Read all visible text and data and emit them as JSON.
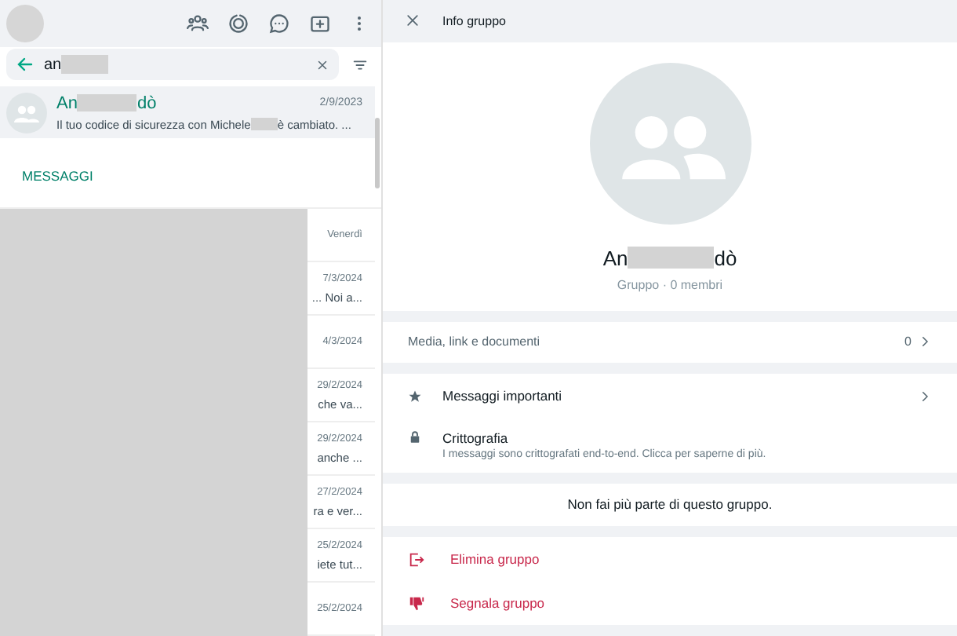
{
  "sidebar": {
    "search": {
      "value": "an"
    },
    "result": {
      "name_start": "An",
      "name_end": "dò",
      "date": "2/9/2023",
      "preview_start": "Il tuo codice di sicurezza con Michele",
      "preview_end": "è cambiato. ...",
      "selected": true
    },
    "section_label": "MESSAGGI",
    "messages": [
      {
        "date": "Venerdì"
      },
      {
        "date": "7/3/2024",
        "snippet": "... Noi a..."
      },
      {
        "date": "4/3/2024"
      },
      {
        "date": "29/2/2024",
        "snippet": "che va..."
      },
      {
        "date": "29/2/2024",
        "snippet": "anche ..."
      },
      {
        "date": "27/2/2024",
        "snippet": "ra e ver..."
      },
      {
        "date": "25/2/2024",
        "snippet": "iete tut..."
      },
      {
        "date": "25/2/2024"
      }
    ]
  },
  "info": {
    "title": "Info gruppo",
    "name_start": "An",
    "name_end": "dò",
    "subtitle": "Gruppo · 0 membri",
    "media": {
      "label": "Media, link e documenti",
      "count": "0"
    },
    "rows": [
      {
        "kind": "starred",
        "label": "Messaggi importanti"
      },
      {
        "kind": "encryption",
        "label": "Crittografia",
        "detail": "I messaggi sono crittografati end-to-end. Clicca per saperne di più."
      }
    ],
    "notice": "Non fai più parte di questo gruppo.",
    "actions": [
      {
        "kind": "exit",
        "label": "Elimina gruppo"
      },
      {
        "kind": "report",
        "label": "Segnala gruppo"
      }
    ]
  }
}
